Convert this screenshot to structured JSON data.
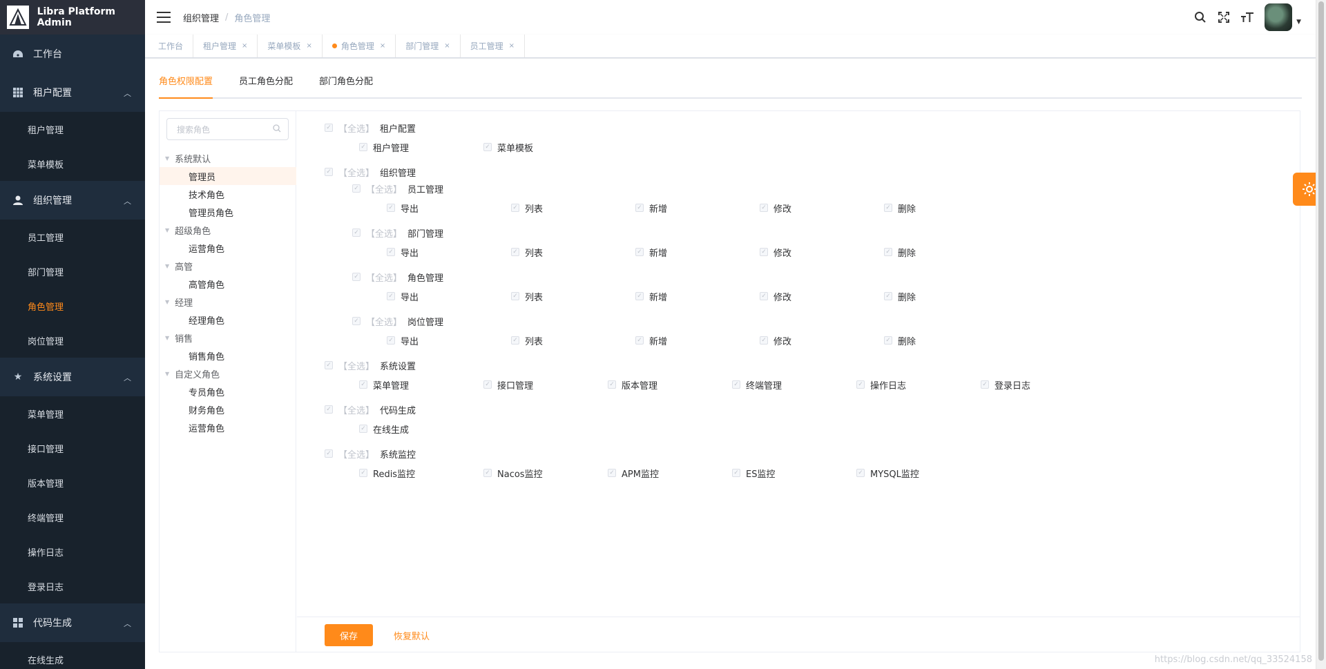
{
  "app": {
    "title": "Libra Platform Admin"
  },
  "sidebar": {
    "groups": [
      {
        "label": "工作台",
        "icon": "dashboard-icon",
        "items": []
      },
      {
        "label": "租户配置",
        "icon": "grid-icon",
        "items": [
          "租户管理",
          "菜单模板"
        ]
      },
      {
        "label": "组织管理",
        "icon": "user-icon",
        "items": [
          "员工管理",
          "部门管理",
          "角色管理",
          "岗位管理"
        ]
      },
      {
        "label": "系统设置",
        "icon": "star-icon",
        "items": [
          "菜单管理",
          "接口管理",
          "版本管理",
          "终端管理",
          "操作日志",
          "登录日志"
        ]
      },
      {
        "label": "代码生成",
        "icon": "apps-icon",
        "items": [
          "在线生成"
        ]
      }
    ],
    "active_item": "角色管理"
  },
  "header": {
    "breadcrumb": [
      "组织管理",
      "角色管理"
    ],
    "icons": [
      "search-icon",
      "fullscreen-icon",
      "font-size-icon"
    ]
  },
  "tags": [
    {
      "label": "工作台",
      "closable": false,
      "active": false
    },
    {
      "label": "租户管理",
      "closable": true,
      "active": false
    },
    {
      "label": "菜单模板",
      "closable": true,
      "active": false
    },
    {
      "label": "角色管理",
      "closable": true,
      "active": true
    },
    {
      "label": "部门管理",
      "closable": true,
      "active": false
    },
    {
      "label": "员工管理",
      "closable": true,
      "active": false
    }
  ],
  "tabs": [
    "角色权限配置",
    "员工角色分配",
    "部门角色分配"
  ],
  "role_tree": {
    "search_placeholder": "搜索角色",
    "nodes": [
      {
        "label": "系统默认",
        "children": [
          "管理员",
          "技术角色",
          "管理员角色"
        ]
      },
      {
        "label": "超级角色",
        "children": [
          "运营角色"
        ]
      },
      {
        "label": "高管",
        "children": [
          "高管角色"
        ]
      },
      {
        "label": "经理",
        "children": [
          "经理角色"
        ]
      },
      {
        "label": "销售",
        "children": [
          "销售角色"
        ]
      },
      {
        "label": "自定义角色",
        "children": [
          "专员角色",
          "财务角色",
          "运营角色"
        ]
      }
    ],
    "selected": "管理员"
  },
  "permissions": {
    "select_all_label": "【全选】",
    "groups": [
      {
        "label": "租户配置",
        "items": [
          "租户管理",
          "菜单模板"
        ]
      },
      {
        "label": "组织管理",
        "subgroups": [
          {
            "label": "员工管理",
            "items": [
              "导出",
              "列表",
              "新增",
              "修改",
              "删除"
            ]
          },
          {
            "label": "部门管理",
            "items": [
              "导出",
              "列表",
              "新增",
              "修改",
              "删除"
            ]
          },
          {
            "label": "角色管理",
            "items": [
              "导出",
              "列表",
              "新增",
              "修改",
              "删除"
            ]
          },
          {
            "label": "岗位管理",
            "items": [
              "导出",
              "列表",
              "新增",
              "修改",
              "删除"
            ]
          }
        ]
      },
      {
        "label": "系统设置",
        "items": [
          "菜单管理",
          "接口管理",
          "版本管理",
          "终端管理",
          "操作日志",
          "登录日志"
        ]
      },
      {
        "label": "代码生成",
        "items": [
          "在线生成"
        ]
      },
      {
        "label": "系统监控",
        "items": [
          "Redis监控",
          "Nacos监控",
          "APM监控",
          "ES监控",
          "MYSQL监控"
        ]
      }
    ]
  },
  "actions": {
    "save": "保存",
    "reset": "恢复默认"
  },
  "watermark": "https://blog.csdn.net/qq_33524158",
  "colors": {
    "accent": "#ff8a1a",
    "sidebar_bg": "#1f2d3d"
  }
}
